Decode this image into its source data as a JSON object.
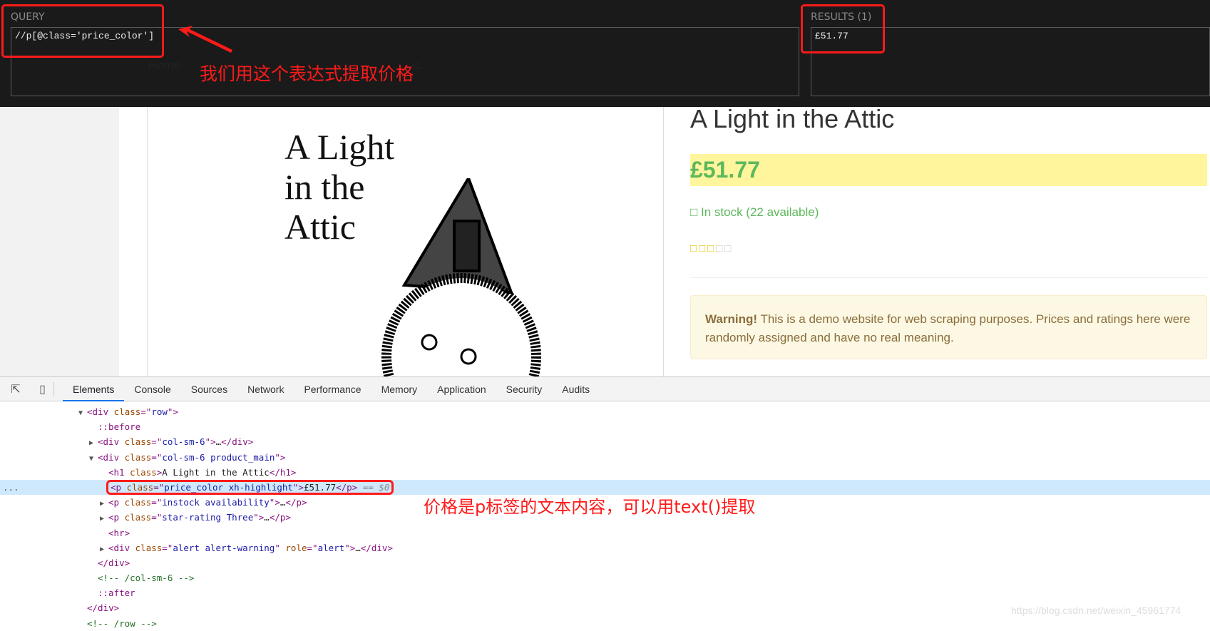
{
  "xpath_helper": {
    "query_label": "QUERY",
    "query_value": "//p[@class='price_color']",
    "results_label": "RESULTS (1)",
    "results_value": "£51.77"
  },
  "annotations": {
    "query_note": "我们用这个表达式提取价格",
    "price_note": "价格是p标签的文本内容，可以用text()提取",
    "color": "#ff1a1a"
  },
  "hidden_breadcrumb": {
    "home": "Home",
    "tail": "ic"
  },
  "product": {
    "cover_title_lines": [
      "A Light",
      "in the",
      "Attic"
    ],
    "title": "A Light in the Attic",
    "price": "£51.77",
    "stock": "□ In stock (22 available)",
    "rating": 3,
    "rating_max": 5,
    "warning_bold": "Warning!",
    "warning_text": " This is a demo website for web scraping purposes. Prices and ratings here were randomly assigned and have no real meaning.",
    "price_color": "#5cb85c",
    "highlight_color": "#fff59d"
  },
  "devtools": {
    "tabs": [
      "Elements",
      "Console",
      "Sources",
      "Network",
      "Performance",
      "Memory",
      "Application",
      "Security",
      "Audits"
    ],
    "active_tab": "Elements",
    "icons": [
      "inspect-element-icon",
      "device-toolbar-icon"
    ],
    "rows": [
      {
        "level": 0,
        "toggle": "open",
        "seg": [
          [
            "tag",
            "<div "
          ],
          [
            "an",
            "class"
          ],
          [
            "tag",
            "=\""
          ],
          [
            "av",
            "row"
          ],
          [
            "tag",
            "\">"
          ]
        ]
      },
      {
        "level": 1,
        "seg": [
          [
            "ps",
            "::before"
          ]
        ]
      },
      {
        "level": 1,
        "toggle": "closed",
        "seg": [
          [
            "tag",
            "<div "
          ],
          [
            "an",
            "class"
          ],
          [
            "tag",
            "=\""
          ],
          [
            "av",
            "col-sm-6"
          ],
          [
            "tag",
            "\">"
          ],
          [
            "tx",
            "…"
          ],
          [
            "tag",
            "</div>"
          ]
        ]
      },
      {
        "level": 1,
        "toggle": "open",
        "seg": [
          [
            "tag",
            "<div "
          ],
          [
            "an",
            "class"
          ],
          [
            "tag",
            "=\""
          ],
          [
            "av",
            "col-sm-6 product_main"
          ],
          [
            "tag",
            "\">"
          ]
        ]
      },
      {
        "level": 2,
        "seg": [
          [
            "tag",
            "<h1 "
          ],
          [
            "an",
            "class"
          ],
          [
            "tag",
            ">"
          ],
          [
            "tx",
            "A Light in the Attic"
          ],
          [
            "tag",
            "</h1>"
          ]
        ]
      },
      {
        "level": 2,
        "selected": true,
        "seg": [
          [
            "tag",
            "<p "
          ],
          [
            "an",
            "class"
          ],
          [
            "tag",
            "=\""
          ],
          [
            "av",
            "price_color xh-highlight"
          ],
          [
            "tag",
            "\">"
          ],
          [
            "tx",
            "£51.77"
          ],
          [
            "tag",
            "</p>"
          ],
          [
            "eq",
            " == $0"
          ]
        ]
      },
      {
        "level": 2,
        "toggle": "closed",
        "seg": [
          [
            "tag",
            "<p "
          ],
          [
            "an",
            "class"
          ],
          [
            "tag",
            "=\""
          ],
          [
            "av",
            "instock availability"
          ],
          [
            "tag",
            "\">"
          ],
          [
            "tx",
            "…"
          ],
          [
            "tag",
            "</p>"
          ]
        ]
      },
      {
        "level": 2,
        "toggle": "closed",
        "seg": [
          [
            "tag",
            "<p "
          ],
          [
            "an",
            "class"
          ],
          [
            "tag",
            "=\""
          ],
          [
            "av",
            "star-rating Three"
          ],
          [
            "tag",
            "\">"
          ],
          [
            "tx",
            "…"
          ],
          [
            "tag",
            "</p>"
          ]
        ]
      },
      {
        "level": 2,
        "seg": [
          [
            "tag",
            "<hr>"
          ]
        ]
      },
      {
        "level": 2,
        "toggle": "closed",
        "seg": [
          [
            "tag",
            "<div "
          ],
          [
            "an",
            "class"
          ],
          [
            "tag",
            "=\""
          ],
          [
            "av",
            "alert alert-warning"
          ],
          [
            "tag",
            "\" "
          ],
          [
            "an",
            "role"
          ],
          [
            "tag",
            "=\""
          ],
          [
            "av",
            "alert"
          ],
          [
            "tag",
            "\">"
          ],
          [
            "tx",
            "…"
          ],
          [
            "tag",
            "</div>"
          ]
        ]
      },
      {
        "level": 1,
        "seg": [
          [
            "tag",
            "</div>"
          ]
        ]
      },
      {
        "level": 1,
        "seg": [
          [
            "cm",
            "<!-- /col-sm-6 -->"
          ]
        ]
      },
      {
        "level": 1,
        "seg": [
          [
            "ps",
            "::after"
          ]
        ]
      },
      {
        "level": 0,
        "seg": [
          [
            "tag",
            "</div>"
          ]
        ]
      },
      {
        "level": 0,
        "seg": [
          [
            "cm",
            "<!-- /row -->"
          ]
        ]
      }
    ],
    "selected_marker": "..."
  },
  "watermark": "https://blog.csdn.net/weixin_45961774"
}
